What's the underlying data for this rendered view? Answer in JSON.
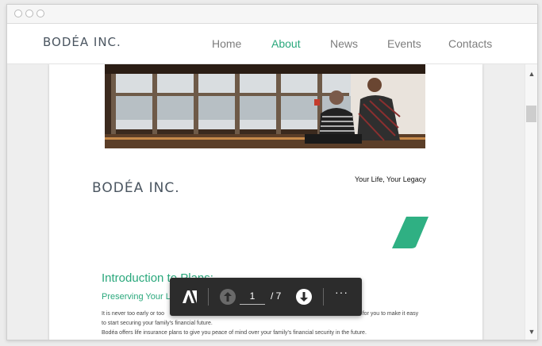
{
  "window": {
    "controls": [
      "close",
      "minimize",
      "maximize"
    ]
  },
  "nav": {
    "logo": "BODÉA INC.",
    "links": [
      {
        "label": "Home",
        "active": false
      },
      {
        "label": "About",
        "active": true
      },
      {
        "label": "News",
        "active": false
      },
      {
        "label": "Events",
        "active": false
      },
      {
        "label": "Contacts",
        "active": false
      }
    ]
  },
  "document": {
    "logo": "BODÉA INC.",
    "tagline": "Your Life, Your Legacy",
    "title": "Introduction to Plans:",
    "subtitle": "Preserving Your L",
    "body_lines": [
      "It is never too early or too late to plan for your future. Bodéa offers a life insurance plan for you to make it easy",
      "to start securing your family's financial future.",
      "Bodéa offers life insurance plans to give you peace of mind over your family's financial security in the future."
    ],
    "body_line_1_left": "It is never too early or too",
    "body_line_1_right": "an for you to make it easy"
  },
  "pdf_toolbar": {
    "current_page": "1",
    "total_pages": "/ 7",
    "more_label": "···"
  },
  "colors": {
    "accent": "#2aa87c",
    "toolbar_bg": "#2c2c2c",
    "logo": "#4a5560"
  },
  "icons": [
    "adobe-icon",
    "page-up-icon",
    "page-down-icon",
    "more-icon",
    "scroll-up-icon",
    "scroll-down-icon"
  ]
}
